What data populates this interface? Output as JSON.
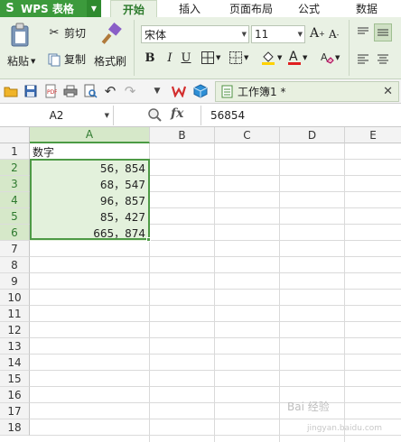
{
  "app": {
    "name": "WPS 表格",
    "logo_letter": "S"
  },
  "menu": {
    "tabs": [
      {
        "label": "开始",
        "active": true
      },
      {
        "label": "插入",
        "active": false
      },
      {
        "label": "页面布局",
        "active": false
      },
      {
        "label": "公式",
        "active": false
      },
      {
        "label": "数据",
        "active": false
      }
    ]
  },
  "ribbon": {
    "paste": "粘贴",
    "cut": "剪切",
    "copy": "复制",
    "format_painter": "格式刷",
    "font_name": "宋体",
    "font_size": "11",
    "bold": "B",
    "italic": "I",
    "underline": "U",
    "font_color": "#e02020",
    "fill_color": "#ffd200"
  },
  "document": {
    "tab_title": "工作簿1 *"
  },
  "formula_bar": {
    "name_box": "A2",
    "fx_label": "fx",
    "content": "56854"
  },
  "sheet": {
    "columns": [
      "A",
      "B",
      "C",
      "D",
      "E"
    ],
    "rows": [
      "1",
      "2",
      "3",
      "4",
      "5",
      "6",
      "7",
      "8",
      "9",
      "10",
      "11",
      "12",
      "13",
      "14",
      "15",
      "16",
      "17",
      "18"
    ],
    "cells": {
      "A1": "数字",
      "A2": "56，854",
      "A3": "68，547",
      "A4": "96，857",
      "A5": "85，427",
      "A6": "665，874"
    },
    "selection": "A2:A6"
  },
  "watermark": {
    "text": "Bai 经验",
    "sub": "jingyan.baidu.com"
  }
}
